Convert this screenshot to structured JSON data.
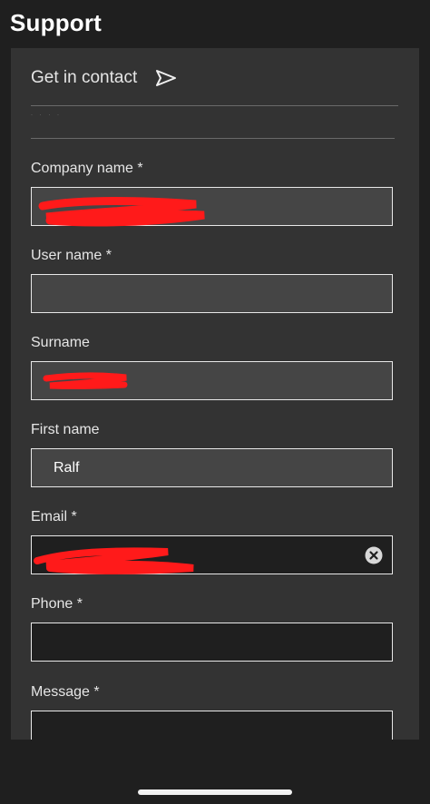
{
  "page": {
    "title": "Support"
  },
  "contact": {
    "header": "Get in contact",
    "faint_text": "· · ·  ·"
  },
  "fields": [
    {
      "label": "Company name *",
      "value": ""
    },
    {
      "label": "User name *",
      "value": ""
    },
    {
      "label": "Surname",
      "value": ""
    },
    {
      "label": "First name",
      "value": "Ralf"
    },
    {
      "label": "Email *",
      "value": ""
    },
    {
      "label": "Phone *",
      "value": ""
    },
    {
      "label": "Message *",
      "value": ""
    }
  ],
  "icons": {
    "send": "send-icon",
    "clear": "clear-icon"
  },
  "colors": {
    "background": "#1f1f1f",
    "card": "#333333",
    "field_fill": "#454545",
    "field_fill_active": "#1f1f1f",
    "redaction": "#ff1a1a"
  }
}
